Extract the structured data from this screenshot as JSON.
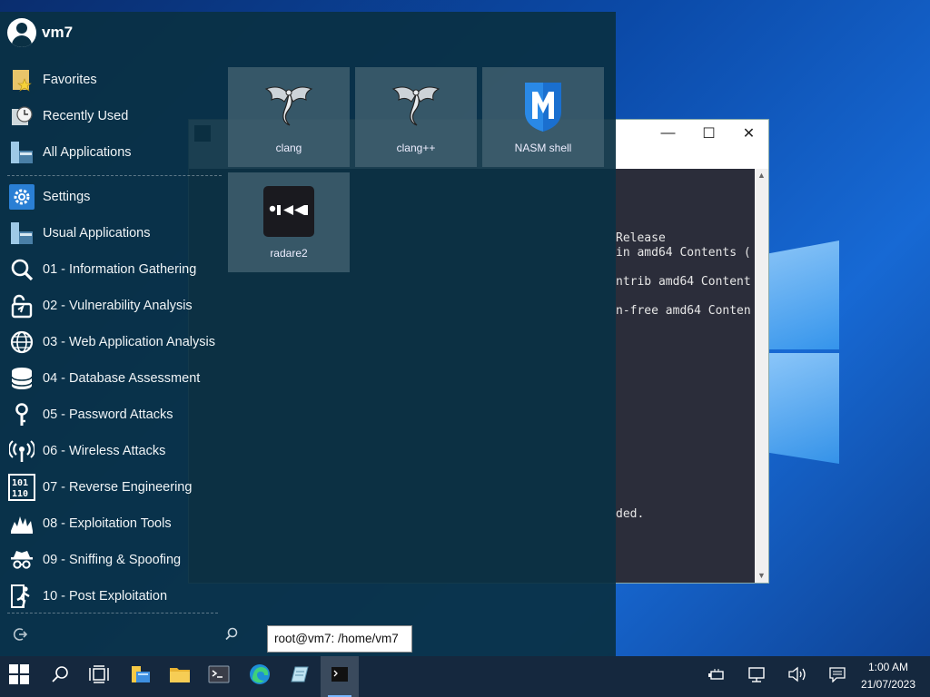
{
  "desktop": {
    "accent_color": "#0b4aa8"
  },
  "terminal_window": {
    "controls": {
      "minimize": "—",
      "maximize": "☐",
      "close": "✕"
    },
    "lines": [
      "Release",
      "in amd64 Contents (",
      "ntrib amd64 Content",
      "n-free amd64 Conten",
      "ded."
    ]
  },
  "start_menu": {
    "user": {
      "name": "vm7"
    },
    "categories_top": [
      {
        "label": "Favorites",
        "icon": "favorites-icon"
      },
      {
        "label": "Recently Used",
        "icon": "recent-icon"
      },
      {
        "label": "All Applications",
        "icon": "all-apps-icon"
      }
    ],
    "categories": [
      {
        "label": "Settings",
        "icon": "settings-gear-icon"
      },
      {
        "label": "Usual Applications",
        "icon": "usual-apps-icon"
      },
      {
        "label": "01 - Information Gathering",
        "icon": "magnifier-icon"
      },
      {
        "label": "02 - Vulnerability Analysis",
        "icon": "vulnerability-icon"
      },
      {
        "label": "03 - Web Application Analysis",
        "icon": "globe-icon"
      },
      {
        "label": "04 - Database Assessment",
        "icon": "database-icon"
      },
      {
        "label": "05 - Password Attacks",
        "icon": "key-icon"
      },
      {
        "label": "06 - Wireless Attacks",
        "icon": "wireless-icon"
      },
      {
        "label": "07 - Reverse Engineering",
        "icon": "binary-icon"
      },
      {
        "label": "08 - Exploitation Tools",
        "icon": "explosion-icon"
      },
      {
        "label": "09 - Sniffing & Spoofing",
        "icon": "spy-icon"
      },
      {
        "label": "10 - Post Exploitation",
        "icon": "running-man-icon"
      }
    ],
    "apps": [
      {
        "label": "clang",
        "icon": "dragon-icon"
      },
      {
        "label": "clang++",
        "icon": "dragon-icon"
      },
      {
        "label": "NASM shell",
        "icon": "metasploit-shield-icon"
      },
      {
        "label": "radare2",
        "icon": "radare2-icon"
      }
    ],
    "search_placeholder": ""
  },
  "tooltip": {
    "text": "root@vm7: /home/vm7"
  },
  "taskbar": {
    "items": [
      {
        "name": "start-button",
        "icon": "windows-logo-icon"
      },
      {
        "name": "search-button",
        "icon": "search-icon"
      },
      {
        "name": "task-view-button",
        "icon": "task-view-icon"
      },
      {
        "name": "file-explorer-button",
        "icon": "file-explorer-icon"
      },
      {
        "name": "folder-button",
        "icon": "folder-icon"
      },
      {
        "name": "terminal-button",
        "icon": "terminal-icon"
      },
      {
        "name": "edge-button",
        "icon": "edge-icon"
      },
      {
        "name": "app-button",
        "icon": "notepad-icon"
      },
      {
        "name": "active-terminal-button",
        "icon": "terminal-icon"
      }
    ],
    "clock": {
      "time": "1:00 AM",
      "date": "21/07/2023"
    }
  }
}
